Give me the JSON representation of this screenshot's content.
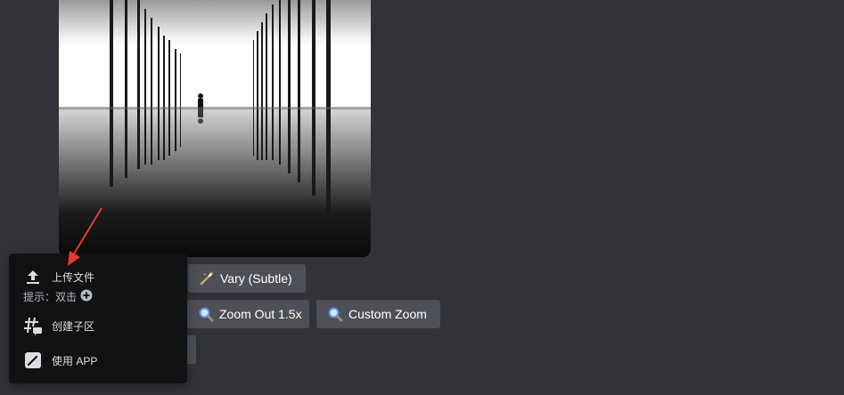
{
  "image": {
    "description_icon": "photo-attachment"
  },
  "buttons": {
    "vary_subtle": "Vary (Subtle)",
    "zoom_out": "Zoom Out 1.5x",
    "custom_zoom": "Custom Zoom"
  },
  "menu": {
    "upload_label": "上传文件",
    "hint_label": "提示：双击",
    "thread_label": "创建子区",
    "app_label": "使用 APP"
  },
  "colors": {
    "background": "#313338",
    "button": "#4e5058",
    "menu_bg": "#111214",
    "arrow": "#e53935"
  }
}
